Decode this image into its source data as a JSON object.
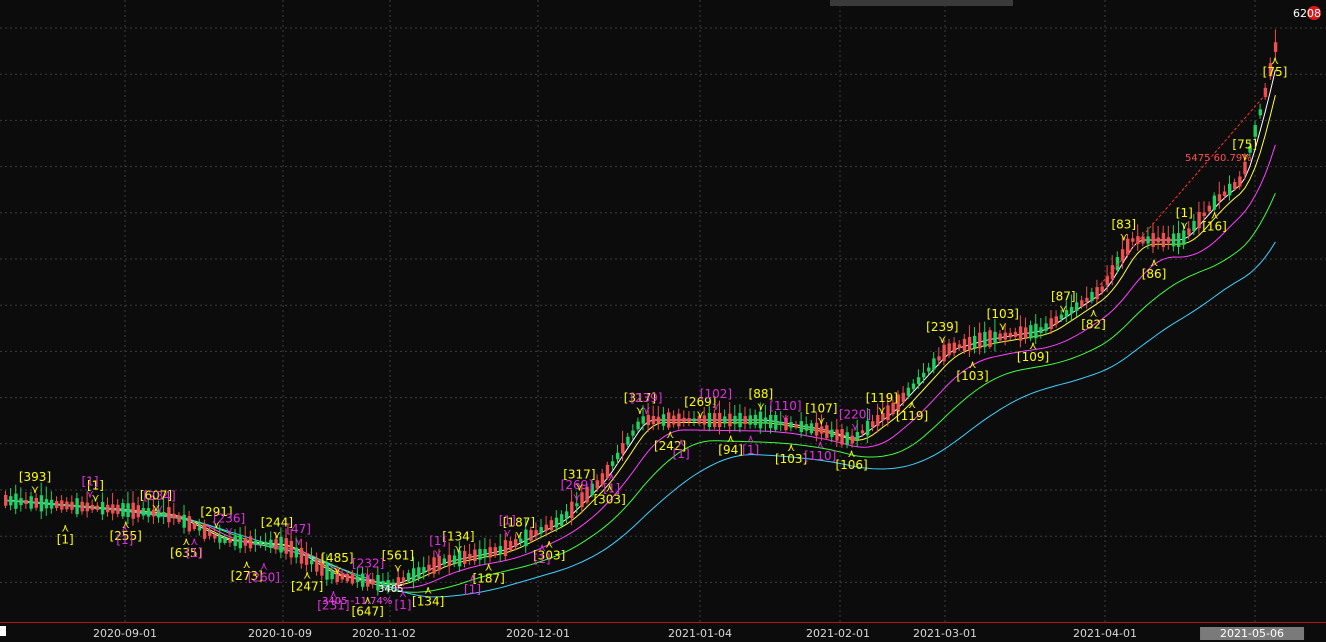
{
  "chart_data": {
    "type": "candlestick",
    "x_labels": [
      "2020-09-01",
      "2020-10-09",
      "2020-11-02",
      "2020-12-01",
      "2021-01-04",
      "2021-02-01",
      "2021-03-01",
      "2021-04-01",
      "2021-05-06"
    ],
    "active_x_label": "2021-05-06",
    "current_price_label": "6208",
    "period_low_label": "3405",
    "change_annotation": "5475 60.79%",
    "low_annotation": "3405 -11.74%",
    "grid": true,
    "colors": {
      "background": "#0c0c0c",
      "grid": "#3c3c3c",
      "up_candle": "#f05050",
      "down_candle": "#20d060",
      "ma5": "#ffffff",
      "ma10": "#ffff40",
      "ma20": "#ff40ff",
      "ma30": "#40ff40",
      "ma60": "#40d0ff",
      "yellow_marker": "#ffff00",
      "magenta_marker": "#e030e0"
    },
    "marker_labels_yellow": [
      "[393]",
      "[1]",
      "[1]",
      "[255]",
      "[607]",
      "[635]",
      "[291]",
      "[273]",
      "[244]",
      "[247]",
      "[485]",
      "[647]",
      "[561]",
      "[134]",
      "[134]",
      "[187]",
      "[187]",
      "[303]",
      "[317]",
      "[303]",
      "[317]",
      "[242]",
      "[269]",
      "[94]",
      "[88]",
      "[103]",
      "[107]",
      "[106]",
      "[119]",
      "[119]",
      "[239]",
      "[103]",
      "[103]",
      "[109]",
      "[87]",
      "[82]",
      "[83]",
      "[86]",
      "[1]",
      "[16]",
      "[75]",
      "[75]"
    ],
    "marker_labels_magenta": [
      "[1]",
      "[1]",
      "[234]",
      "[1]",
      "[236]",
      "[260]",
      "[47]",
      "[231]",
      "[232]",
      "[1]",
      "[1]",
      "[1]",
      "[1]",
      "[1]",
      "[269]",
      "[1]",
      "[239]",
      "[1]",
      "[102]",
      "[1]",
      "[110]",
      "[110]",
      "[220]"
    ]
  }
}
